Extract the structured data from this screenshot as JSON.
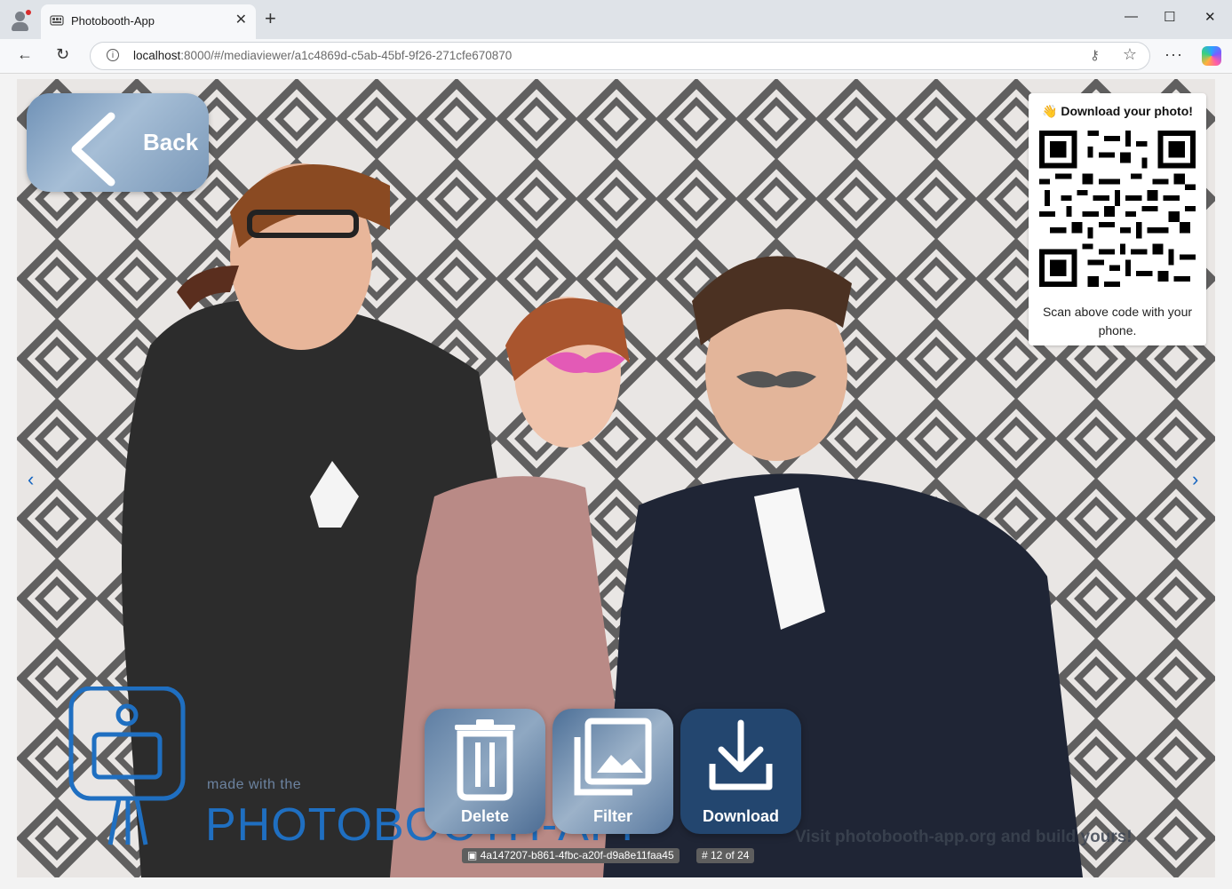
{
  "browser": {
    "tab_title": "Photobooth-App",
    "url_host": "localhost",
    "url_rest": ":8000/#/mediaviewer/a1c4869d-c5ab-45bf-9f26-271cfe670870",
    "icons": {
      "profile": "profile-icon",
      "tab_favicon": "gallery-icon",
      "close_tab": "close-icon",
      "new_tab": "plus-icon",
      "minimize": "minimize-icon",
      "maximize": "maximize-icon",
      "close_window": "close-icon",
      "back": "arrow-left-icon",
      "reload": "reload-icon",
      "site_info": "info-icon",
      "password": "key-icon",
      "favorite": "star-icon",
      "menu": "more-icon",
      "copilot": "copilot-icon"
    },
    "tab_close_glyph": "✕",
    "new_tab_glyph": "+",
    "minimize_glyph": "—",
    "maximize_glyph": "☐",
    "close_window_glyph": "✕",
    "back_glyph": "←",
    "reload_glyph": "↻",
    "info_glyph": "i",
    "key_glyph": "⚷",
    "star_glyph": "☆",
    "more_glyph": "···"
  },
  "viewer": {
    "back_label": "Back",
    "qr": {
      "heading": "👋 Download your photo!",
      "hint": "Scan above code with your phone."
    },
    "prev_glyph": "‹",
    "next_glyph": "›",
    "watermark": {
      "made_with": "made with the",
      "brand": "PHOTOBOOTH-APP",
      "visit": "Visit photobooth-app.org and build yours!"
    },
    "actions": {
      "delete": "Delete",
      "filter": "Filter",
      "download": "Download"
    },
    "media_id": "4a147207-b861-4fbc-a20f-d9a8e11faa45",
    "position": "# 12 of 24",
    "colors": {
      "accent": "#1565c0",
      "download_bg": "#23466f",
      "brand_blue": "#1f6fc1"
    }
  }
}
